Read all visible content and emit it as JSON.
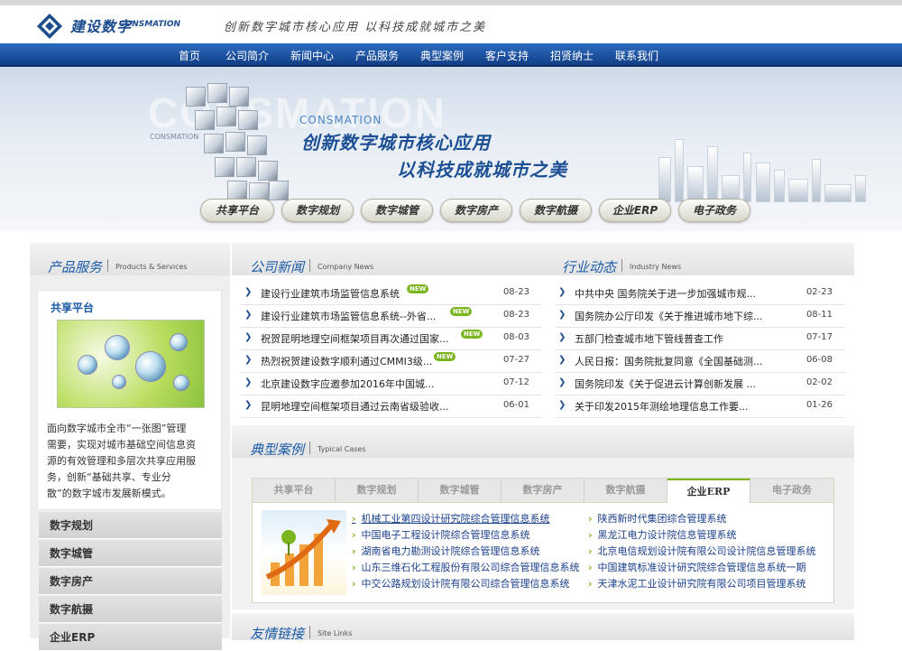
{
  "header": {
    "logo_cn": "建设数字",
    "logo_en": "CONSMATION",
    "slogan": "创新数字城市核心应用  以科技成就城市之美"
  },
  "nav": [
    "首页",
    "公司简介",
    "新闻中心",
    "产品服务",
    "典型案例",
    "客户支持",
    "招贤纳士",
    "联系我们"
  ],
  "banner": {
    "bg_text": "CONSMATION",
    "bg_sub": "CONSMATION",
    "en": "CONSMATION",
    "line1": "创新数字城市核心应用",
    "line2": "以科技成就城市之美",
    "pills": [
      "共享平台",
      "数字规划",
      "数字城管",
      "数字房产",
      "数字航摄",
      "企业ERP",
      "电子政务"
    ]
  },
  "products": {
    "title": "产品服务",
    "en": "Products & Services",
    "share_title": "共享平台",
    "share_desc": "面向数字城市全市“一张图”管理\n需要，实现对城市基础空间信息资\n源的有效管理和多层次共享应用服\n务，创新“基础共享、专业分\n散”的数字城市发展新模式。",
    "items": [
      "数字规划",
      "数字城管",
      "数字房产",
      "数字航摄",
      "企业ERP"
    ]
  },
  "company_news": {
    "title": "公司新闻",
    "en": "Company News",
    "items": [
      {
        "text": "建设行业建筑市场监管信息系统",
        "date": "08-23",
        "badge": "NEW"
      },
      {
        "text": "建设行业建筑市场监管信息系统--外省...",
        "date": "08-23",
        "badge": "NEW"
      },
      {
        "text": "祝贺昆明地理空间框架项目再次通过国家...",
        "date": "08-03",
        "badge": "NEW"
      },
      {
        "text": "热烈祝贺建设数字顺利通过CMMI3级...",
        "date": "07-27",
        "badge": "NEW"
      },
      {
        "text": "北京建设数字应邀参加2016年中国城...",
        "date": "07-12",
        "badge": ""
      },
      {
        "text": "昆明地理空间框架项目通过云南省级验收...",
        "date": "06-01",
        "badge": ""
      }
    ]
  },
  "industry_news": {
    "title": "行业动态",
    "en": "Industry News",
    "items": [
      {
        "text": "中共中央 国务院关于进一步加强城市规...",
        "date": "02-23"
      },
      {
        "text": "国务院办公厅印发《关于推进城市地下综...",
        "date": "08-11"
      },
      {
        "text": "五部门检查城市地下管线普查工作",
        "date": "07-17"
      },
      {
        "text": "人民日报：国务院批复同意《全国基础测...",
        "date": "06-08"
      },
      {
        "text": "国务院印发《关于促进云计算创新发展 ...",
        "date": "02-02"
      },
      {
        "text": "关于印发2015年测绘地理信息工作要...",
        "date": "01-26"
      }
    ]
  },
  "cases": {
    "title": "典型案例",
    "en": "Typical Cases",
    "tabs": [
      "共享平台",
      "数字规划",
      "数字城管",
      "数字房产",
      "数字航摄",
      "企业ERP",
      "电子政务"
    ],
    "active_tab": "企业ERP",
    "left_links": [
      "机械工业第四设计研究院综合管理信息系统",
      "中国电子工程设计院综合管理信息系统",
      "湖南省电力勘测设计院综合管理信息系统",
      "山东三维石化工程股份有限公司综合管理信息系统",
      "中交公路规划设计院有限公司综合管理信息系统"
    ],
    "right_links": [
      "陕西新时代集团综合管理系统",
      "黑龙江电力设计院信息管理系统",
      "北京电信规划设计院有限公司设计院信息管理系统",
      "中国建筑标准设计研究院综合管理信息系统一期",
      "天津水泥工业设计研究院有限公司项目管理系统"
    ]
  },
  "links": {
    "title": "友情链接",
    "en": "Site Links"
  },
  "colors": {
    "nav": "#1b4c8c",
    "accent_green": "#7ab51d",
    "title_blue": "#1b5aa6"
  }
}
